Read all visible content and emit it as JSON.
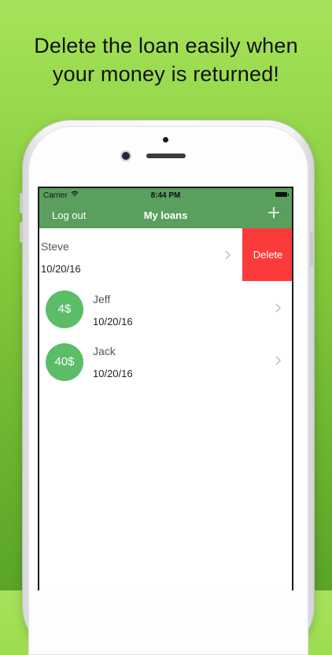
{
  "headline": {
    "line1": "Delete the loan easily when",
    "line2": "your money is returned!"
  },
  "status_bar": {
    "carrier": "Carrier",
    "time": "8:44 PM"
  },
  "navbar": {
    "left_label": "Log out",
    "title": "My loans"
  },
  "loans": [
    {
      "name": "Steve",
      "date": "10/20/16",
      "amount": "",
      "swiped": true
    },
    {
      "name": "Jeff",
      "date": "10/20/16",
      "amount": "4$"
    },
    {
      "name": "Jack",
      "date": "10/20/16",
      "amount": "40$"
    }
  ],
  "row_action": {
    "delete_label": "Delete"
  },
  "colors": {
    "background_top": "#a6e35a",
    "background_bottom": "#5aa427",
    "navbar": "#5a9f5e",
    "badge": "#5cbd68",
    "delete": "#fb3b3b"
  },
  "icons": {
    "add": "plus-icon",
    "disclosure": "chevron-right-icon",
    "wifi": "wifi-icon",
    "battery": "battery-icon"
  }
}
